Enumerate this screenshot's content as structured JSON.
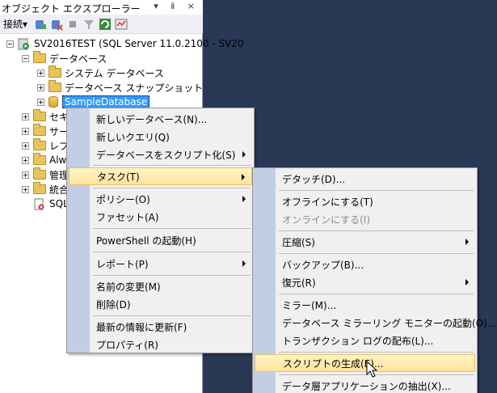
{
  "panel": {
    "title": "オブジェクト エクスプローラー",
    "title_buttons": "▾ ⅱ ×"
  },
  "toolbar": {
    "connect_label": "接続▾",
    "icons": [
      "connect-db-icon",
      "disconnect-icon",
      "stop-icon",
      "filter-icon",
      "refresh-icon",
      "activity-monitor-icon"
    ]
  },
  "tree": {
    "server": "SV2016TEST (SQL Server 11.0.2100 - SV20",
    "databases": "データベース",
    "system_databases": "システム データベース",
    "snapshots": "データベース スナップショット",
    "sample_db": "SampleDatabase",
    "partial_items": [
      "セキ",
      "サー",
      "レプ",
      "Alwa",
      "管理",
      "統合",
      "SQL"
    ]
  },
  "context_menu": {
    "items": [
      "新しいデータベース(N)...",
      "新しいクエリ(Q)",
      "データベースをスクリプト化(S)",
      "タスク(T)",
      "ポリシー(O)",
      "ファセット(A)",
      "PowerShell の起動(H)",
      "レポート(P)",
      "名前の変更(M)",
      "削除(D)",
      "最新の情報に更新(F)",
      "プロパティ(R)"
    ]
  },
  "tasks_menu": {
    "items": [
      "デタッチ(D)...",
      "オフラインにする(T)",
      "オンラインにする(I)",
      "圧縮(S)",
      "バックアップ(B)...",
      "復元(R)",
      "ミラー(M)...",
      "データベース ミラーリング モニターの起動(O)...",
      "トランザクション ログの配布(L)...",
      "スクリプトの生成(E)...",
      "データ層アプリケーションの抽出(X)..."
    ]
  },
  "colors": {
    "background": "#293955",
    "menu_gutter": "#c2cde6",
    "highlight": "#ffe49b",
    "selection": "#3399ff"
  }
}
